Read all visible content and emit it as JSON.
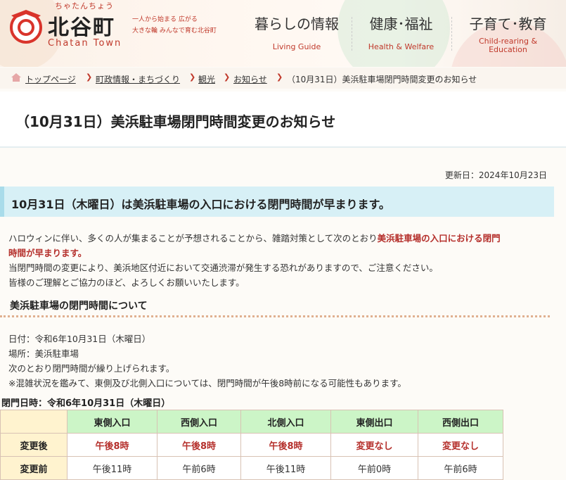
{
  "header": {
    "kana": "ちゃたんちょう",
    "town_name": "北谷町",
    "town_name_en": "Chatan Town",
    "tagline_1": "一人から始まる 広がる",
    "tagline_2": "大きな輪 みんなで育む北谷町",
    "nav": [
      {
        "jp": "暮らしの情報",
        "en": "Living Guide"
      },
      {
        "jp": "健康･福祉",
        "en": "Health & Welfare"
      },
      {
        "jp": "子育て･教育",
        "en": "Child-rearing &",
        "en2": "Education"
      }
    ]
  },
  "breadcrumb": [
    "トップページ",
    "町政情報・まちづくり",
    "観光",
    "お知らせ",
    "（10月31日）美浜駐車場閉門時間変更のお知らせ"
  ],
  "page_title": "（10月31日）美浜駐車場閉門時間変更のお知らせ",
  "updated": "更新日：2024年10月23日",
  "subheading": "10月31日（木曜日）は美浜駐車場の入口における閉門時間が早まります。",
  "body": {
    "p1_a": "ハロウィンに伴い、多くの人が集まることが予想されることから、雑踏対策として次のとおり",
    "p1_b": "美浜駐車場の入口における閉門",
    "p1_c": "時間が早まります。",
    "p2": "当閉門時間の変更により、美浜地区付近において交通渋滞が発生する恐れがありますので、ご注意ください。",
    "p3": "皆様のご理解とご協力のほど、よろしくお願いいたします。"
  },
  "section_title": "美浜駐車場の閉門時間について",
  "info": [
    "日付：令和6年10月31日（木曜日）",
    "場所：美浜駐車場",
    "次のとおり閉門時間が繰り上げられます。",
    "※混雑状況を鑑みて、東側及び北側入口については、閉門時間が午後8時前になる可能性もあります。"
  ],
  "table": {
    "caption": "閉門日時：令和6年10月31日（木曜日）",
    "columns": [
      "東側入口",
      "西側入口",
      "北側入口",
      "東側出口",
      "西側出口"
    ],
    "rows": [
      {
        "label": "変更後",
        "values": [
          "午後8時",
          "午後8時",
          "午後8時",
          "変更なし",
          "変更なし"
        ]
      },
      {
        "label": "変更前",
        "values": [
          "午後11時",
          "午前6時",
          "午後11時",
          "午前0時",
          "午前6時"
        ]
      }
    ]
  },
  "colors": {
    "accent_red": "#c0392b",
    "subhead_bg": "#d7f0f6",
    "table_header_green": "#ccf5c7",
    "table_row_header_yellow": "#fff3cf"
  }
}
